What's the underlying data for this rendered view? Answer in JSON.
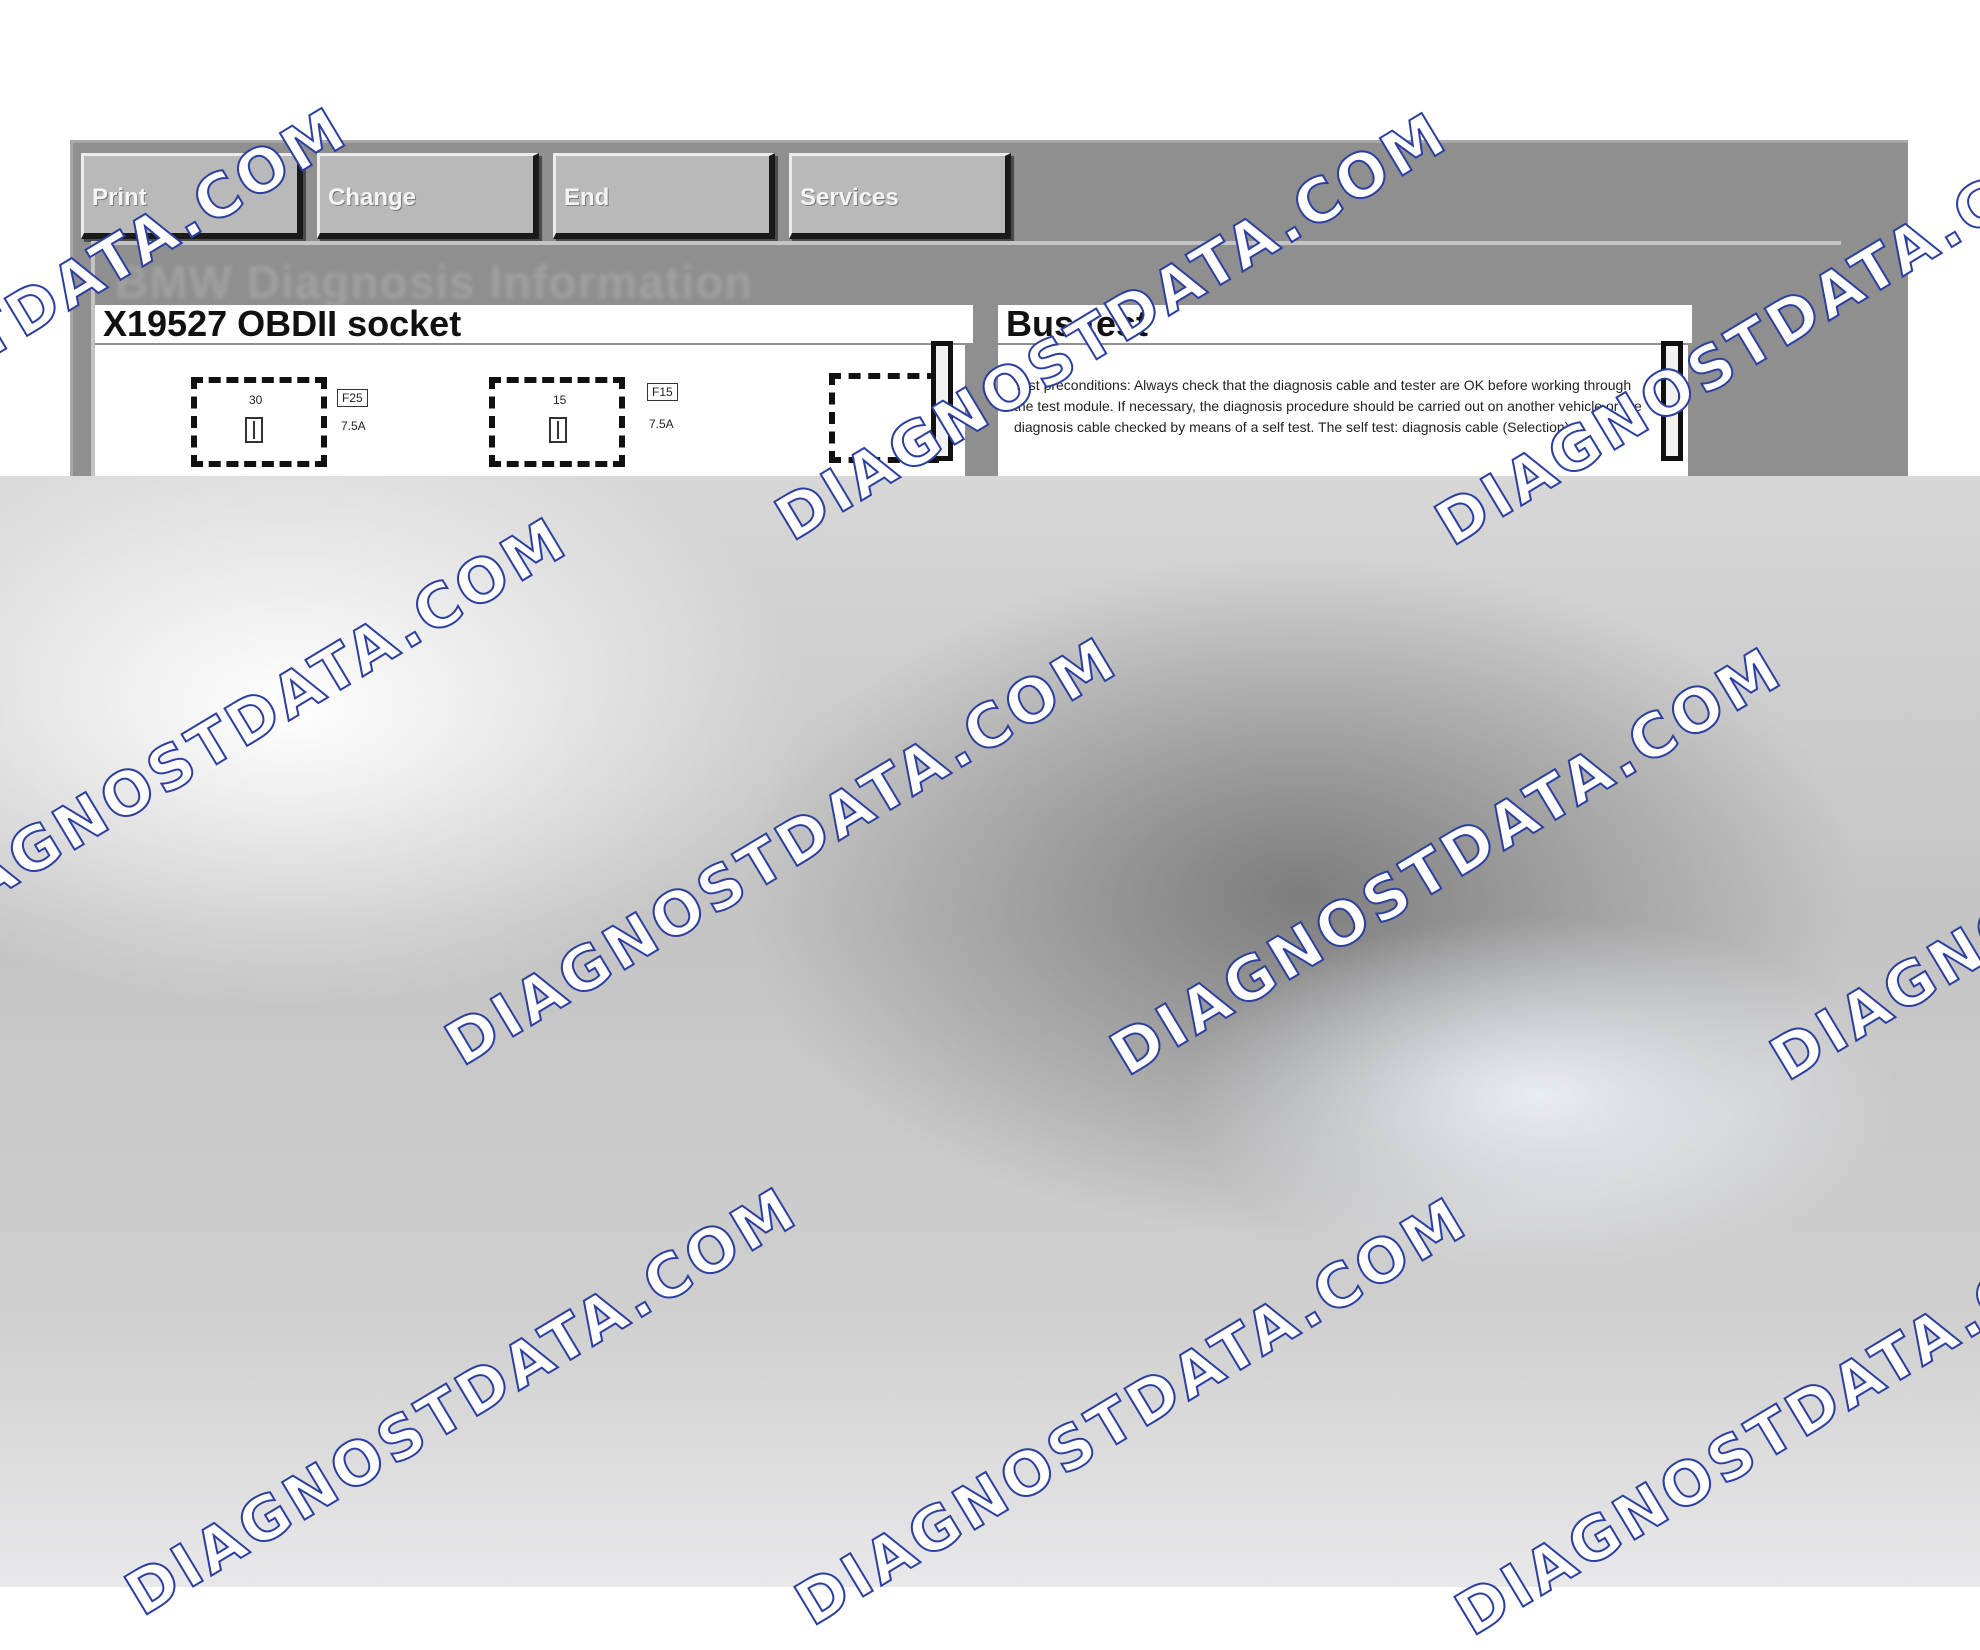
{
  "toolbar": {
    "buttons": [
      {
        "label": "Print"
      },
      {
        "label": "Change"
      },
      {
        "label": "End"
      },
      {
        "label": "Services"
      }
    ]
  },
  "app": {
    "header": "BMW Diagnosis Information"
  },
  "left_panel": {
    "title": "X19527 OBDII socket",
    "fuses": [
      {
        "terminal": "30",
        "fuse": "F25",
        "rating": "7.5A"
      },
      {
        "terminal": "15",
        "fuse": "F15",
        "rating": "7.5A"
      }
    ]
  },
  "right_panel": {
    "title": "Bus test",
    "text": "Test preconditions: Always check that the diagnosis cable and tester are OK before working through the test module. If necessary, the diagnosis procedure should be carried out on another vehicle or the diagnosis cable checked by means of a self test. The self test: diagnosis cable (Selection)"
  },
  "watermark": {
    "text": "DIAGNOSTDATA.COM",
    "color": "#2c3fa0"
  }
}
